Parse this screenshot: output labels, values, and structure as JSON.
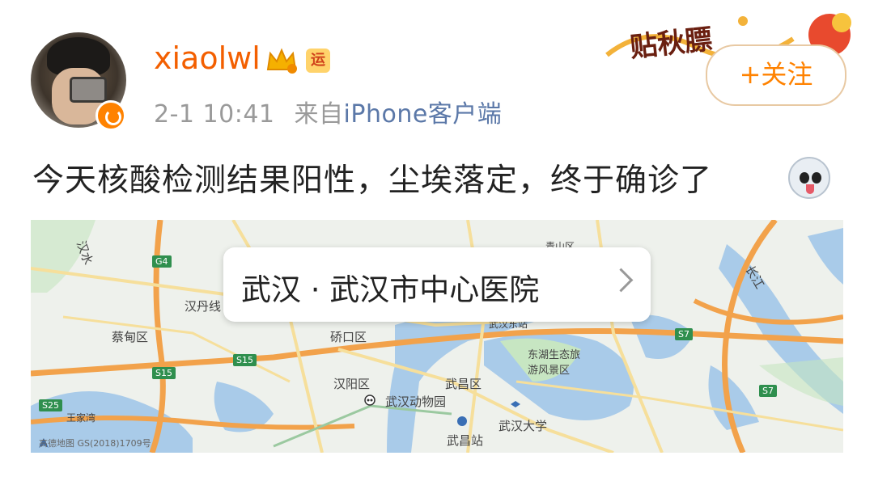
{
  "post": {
    "username": "xiaolwl",
    "badge_yun": "运",
    "time": "2-1 10:41",
    "from_prefix": "来自",
    "source": "iPhone客户端",
    "follow_label": "+关注",
    "banner_text": "贴秋膘",
    "content": "今天核酸检测结果阳性，尘埃落定，终于确诊了"
  },
  "location": {
    "label": "武汉 · 武汉市中心医院"
  },
  "map": {
    "labels": [
      "汉水",
      "G4",
      "汉丹线",
      "蔡甸区",
      "S15",
      "S15",
      "S25",
      "硚口区",
      "汉阳区",
      "武汉动物园",
      "武昌区",
      "武昌站",
      "武汉大学",
      "东湖生态旅游风景区",
      "武汉东站",
      "S7",
      "S7",
      "长江",
      "青山区",
      "王家湾"
    ],
    "credit": "高德地图 GS(2018)1709号",
    "colors": {
      "water": "#a9cbe9",
      "green": "#c7e6c2",
      "highway": "#f2a24b",
      "road": "#f6df9b"
    }
  }
}
